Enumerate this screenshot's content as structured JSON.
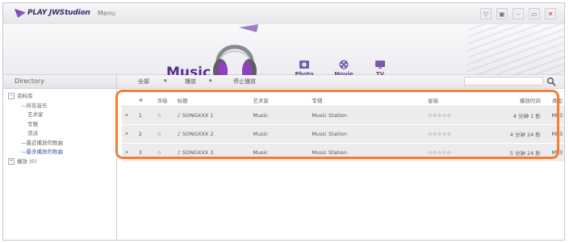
{
  "window": {
    "app_title": "PLAY JWStudion",
    "menu_label": "Menu",
    "controls": [
      "▽",
      "▣",
      "–",
      "▭",
      "✕"
    ]
  },
  "banner": {
    "section_title": "Music",
    "nav": [
      {
        "label": "Photo",
        "icon": "photo-icon"
      },
      {
        "label": "Movie",
        "icon": "movie-icon"
      },
      {
        "label": "TV",
        "icon": "tv-icon"
      }
    ]
  },
  "sidebar": {
    "header": "Directory",
    "items": [
      {
        "label": "资料库",
        "toggle": "−"
      },
      {
        "label": "—所有音乐",
        "toggle": ""
      },
      {
        "label": "艺术家",
        "toggle": ""
      },
      {
        "label": "专辑",
        "toggle": ""
      },
      {
        "label": "流派",
        "toggle": ""
      },
      {
        "label": "—最近播放的歌曲",
        "toggle": ""
      },
      {
        "label": "—最多播放的歌曲",
        "toggle": ""
      },
      {
        "label": "播放 (0)",
        "toggle": "+"
      }
    ]
  },
  "toolbar": {
    "items": [
      "全部",
      "▾",
      "播放",
      "▾",
      "停止播放"
    ],
    "search_placeholder": ""
  },
  "table": {
    "columns": [
      "",
      "#",
      "评级",
      "标题",
      "艺术家",
      "专辑",
      "星级",
      "播放时间",
      "类型"
    ],
    "rows": [
      {
        "num": "1",
        "rating": "☆",
        "title": "♪ SONGXXX 1",
        "artist": "Music",
        "album": "Music Station",
        "stars": "☆☆☆☆☆",
        "time": "4 分钟 1 秒",
        "type": "MP3"
      },
      {
        "num": "2",
        "rating": "☆",
        "title": "♪ SONGXXX 2",
        "artist": "Music",
        "album": "Music Station",
        "stars": "☆☆☆☆☆",
        "time": "4 分钟 24 秒",
        "type": "MP3"
      },
      {
        "num": "3",
        "rating": "☆",
        "title": "♪ SONGXXX 3",
        "artist": "Music",
        "album": "Music Station",
        "stars": "☆☆☆☆☆",
        "time": "5 分钟 24 秒",
        "type": "MP3"
      }
    ]
  },
  "colors": {
    "accent": "#5b2f8c",
    "highlight": "#f27d35"
  }
}
